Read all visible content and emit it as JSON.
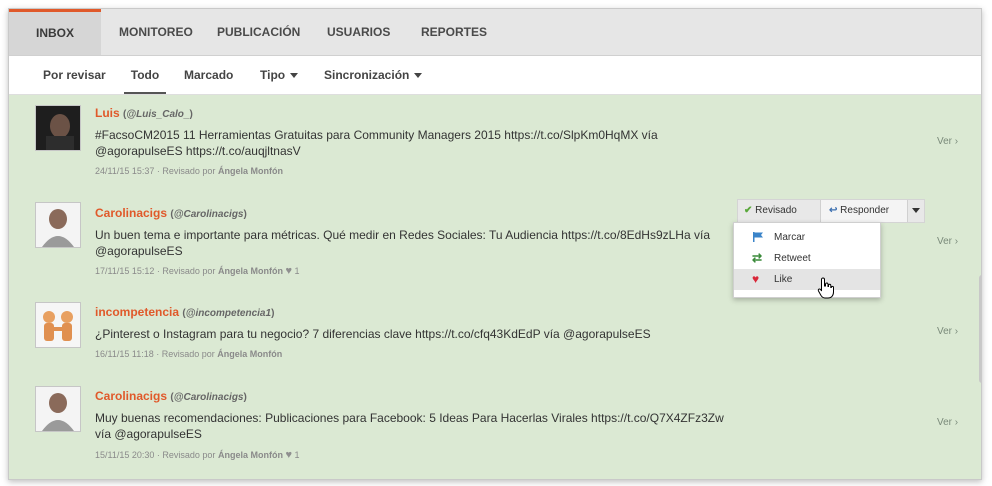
{
  "topnav": {
    "tabs": [
      {
        "label": "INBOX"
      },
      {
        "label": "MONITOREO"
      },
      {
        "label": "PUBLICACIÓN"
      },
      {
        "label": "USUARIOS"
      },
      {
        "label": "REPORTES"
      }
    ]
  },
  "subnav": {
    "items": [
      {
        "label": "Por revisar"
      },
      {
        "label": "Todo"
      },
      {
        "label": "Marcado"
      },
      {
        "label": "Tipo"
      },
      {
        "label": "Sincronización"
      }
    ]
  },
  "messages": [
    {
      "author": "Luis",
      "handle": "@Luis_Calo_",
      "text": "#FacsoCM2015 11 Herramientas Gratuitas para Community Managers 2015 https://t.co/SlpKm0HqMX vía @agorapulseES https://t.co/auqjltnasV",
      "date": "24/11/15 15:37",
      "revised_prefix": "· Revisado por",
      "reviewer": "Ángela Monfón",
      "likes": "",
      "ver": "Ver"
    },
    {
      "author": "Carolinacigs",
      "handle": "@Carolinacigs",
      "text": "Un buen tema e importante para métricas. Qué medir en Redes Sociales: Tu Audiencia https://t.co/8EdHs9zLHa vía @agorapulseES",
      "date": "17/11/15 15:12",
      "revised_prefix": "· Revisado por",
      "reviewer": "Ángela Monfón",
      "likes": "1",
      "ver": "Ver"
    },
    {
      "author": "incompetencia",
      "handle": "@incompetencia1",
      "text": "¿Pinterest o Instagram para tu negocio? 7 diferencias clave https://t.co/cfq43KdEdP vía @agorapulseES",
      "date": "16/11/15 11:18",
      "revised_prefix": "· Revisado por",
      "reviewer": "Ángela Monfón",
      "likes": "",
      "ver": "Ver"
    },
    {
      "author": "Carolinacigs",
      "handle": "@Carolinacigs",
      "text": "Muy buenas recomendaciones: Publicaciones para Facebook: 5 Ideas Para Hacerlas Virales https://t.co/Q7X4ZFz3Zw vía @agorapulseES",
      "date": "15/11/15 20:30",
      "revised_prefix": "· Revisado por",
      "reviewer": "Ángela Monfón",
      "likes": "1",
      "ver": "Ver"
    }
  ],
  "actions": {
    "revisado": "Revisado",
    "responder": "Responder"
  },
  "menu": {
    "items": [
      {
        "label": "Marcar"
      },
      {
        "label": "Retweet"
      },
      {
        "label": "Like"
      }
    ]
  },
  "colors": {
    "accent": "#e0592a",
    "background": "#dbe9d3",
    "like": "#d9283a",
    "flag": "#3b84c9",
    "retweet": "#3a8a3a"
  }
}
